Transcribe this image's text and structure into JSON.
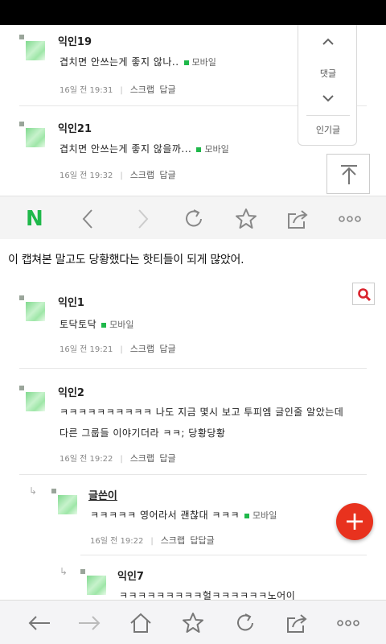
{
  "top_comments": [
    {
      "nickname": "익인19",
      "text": "겹치면 안쓰는게 좋지 않나..",
      "mobile_label": "모바일",
      "time": "16일 전 19:31",
      "scrap": "스크랩",
      "reply": "답글"
    },
    {
      "nickname": "익인21",
      "text": "겹치면 안쓰는게 좋지 않을까...",
      "mobile_label": "모바일",
      "time": "16일 전 19:32",
      "scrap": "스크랩",
      "reply": "답글"
    }
  ],
  "side_nav": {
    "comments_label": "댓글",
    "popular_label": "인기글"
  },
  "toolbar_top": {
    "logo": "N",
    "icons": [
      "back-icon",
      "forward-icon",
      "refresh-icon",
      "star-icon",
      "share-icon",
      "more-icon"
    ]
  },
  "caption": "이 캡쳐본 말고도 당황했다는 핫티들이 되게 많았어.",
  "comments": [
    {
      "nickname": "익인1",
      "text": "토닥토닥",
      "mobile_label": "모바일",
      "time": "16일 전 19:21",
      "scrap": "스크랩",
      "reply": "답글"
    },
    {
      "nickname": "익인2",
      "text_line1": "ㅋㅋㅋㅋㅋㅋㅋㅋㅋㅋ 나도 지금 몇시 보고 투피엠 글인줄 알았는데",
      "text_line2": "다른 그룹들 이야기더라 ㅋㅋ; 당황당황",
      "time": "16일 전 19:22",
      "scrap": "스크랩",
      "reply": "답글"
    }
  ],
  "replies": [
    {
      "nickname": "글쓴이",
      "text": "ㅋㅋㅋㅋㅋ 영어라서 괜찮대 ㅋㅋㅋ",
      "mobile_label": "모바일",
      "time": "16일 전 19:22",
      "scrap": "스크랩",
      "reply": "답답글"
    },
    {
      "nickname": "익인7",
      "text": "ㅋㅋㅋㅋㅋㅋㅋㅋㅋ헐ㅋㅋㅋㅋㅋㅋ노어이"
    }
  ],
  "fab_label": "+",
  "toolbar_bottom": {
    "icons": [
      "back-arrow-icon",
      "forward-arrow-icon",
      "home-icon",
      "star-icon",
      "refresh-icon",
      "share-icon",
      "more-icon"
    ]
  },
  "colors": {
    "accent_green": "#1fb84a",
    "fab_red": "#e8321e",
    "search_red": "#d9232d"
  }
}
